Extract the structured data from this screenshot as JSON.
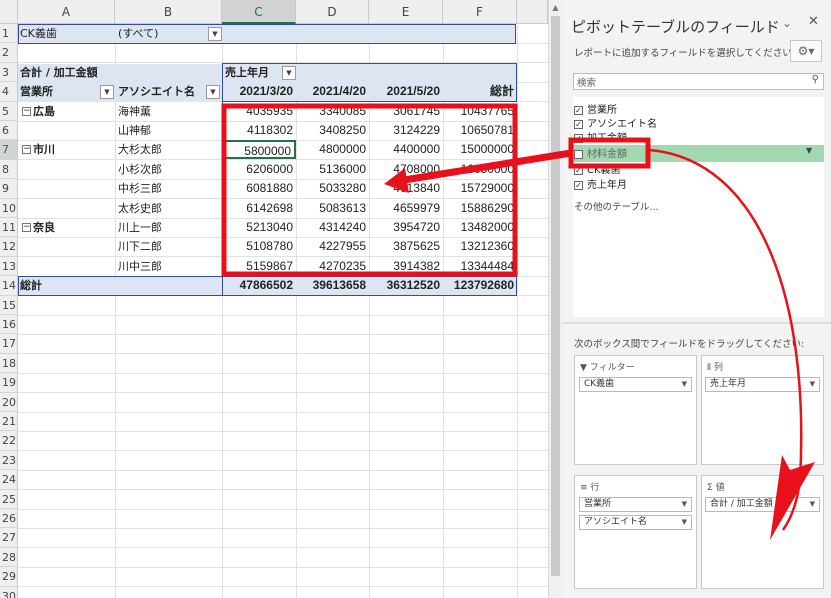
{
  "sheet": {
    "columns": [
      "A",
      "B",
      "C",
      "D",
      "E",
      "F"
    ],
    "rows": [
      "1",
      "2",
      "3",
      "4",
      "5",
      "6",
      "7",
      "8",
      "9",
      "10",
      "11",
      "12",
      "13",
      "14",
      "15",
      "16",
      "17",
      "18",
      "19",
      "20",
      "21",
      "22",
      "23",
      "24",
      "25",
      "26",
      "27",
      "28",
      "29",
      "30"
    ],
    "filter": {
      "label": "CK義歯",
      "value": "(すべて)"
    },
    "pivot": {
      "value_header": "合計 / 加工金額",
      "col_field": "売上年月",
      "row_field_1": "営業所",
      "row_field_2": "アソシエイト名",
      "dates": [
        "2021/3/20",
        "2021/4/20",
        "2021/5/20",
        "総計"
      ],
      "groups": [
        {
          "name": "広島",
          "members": [
            {
              "name": "海神薫",
              "values": [
                "4035935",
                "3340085",
                "3061745",
                "10437765"
              ]
            },
            {
              "name": "山神郁",
              "values": [
                "4118302",
                "3408250",
                "3124229",
                "10650781"
              ]
            }
          ]
        },
        {
          "name": "市川",
          "members": [
            {
              "name": "大杉太郎",
              "values": [
                "5800000",
                "4800000",
                "4400000",
                "15000000"
              ]
            },
            {
              "name": "小杉次郎",
              "values": [
                "6206000",
                "5136000",
                "4708000",
                "16050000"
              ]
            },
            {
              "name": "中杉三郎",
              "values": [
                "6081880",
                "5033280",
                "4613840",
                "15729000"
              ]
            },
            {
              "name": "太杉史郎",
              "values": [
                "6142698",
                "5083613",
                "4659979",
                "15886290"
              ]
            }
          ]
        },
        {
          "name": "奈良",
          "members": [
            {
              "name": "川上一郎",
              "values": [
                "5213040",
                "4314240",
                "3954720",
                "13482000"
              ]
            },
            {
              "name": "川下二郎",
              "values": [
                "5108780",
                "4227955",
                "3875625",
                "13212360"
              ]
            },
            {
              "name": "川中三郎",
              "values": [
                "5159867",
                "4270235",
                "3914382",
                "13344484"
              ]
            }
          ]
        }
      ],
      "total_label": "総計",
      "totals": [
        "47866502",
        "39613658",
        "36312520",
        "123792680"
      ]
    }
  },
  "pane": {
    "title": "ピボットテーブルのフィールド",
    "subtitle": "レポートに追加するフィールドを選択してください:",
    "search_placeholder": "検索",
    "fields": [
      {
        "label": "営業所",
        "checked": true
      },
      {
        "label": "アソシエイト名",
        "checked": true
      },
      {
        "label": "加工金額",
        "checked": true
      },
      {
        "label": "材料金額",
        "checked": false
      },
      {
        "label": "CK義歯",
        "checked": true
      },
      {
        "label": "売上年月",
        "checked": true
      }
    ],
    "more_tables": "その他のテーブル...",
    "drag_hint": "次のボックス間でフィールドをドラッグしてください:",
    "areas": {
      "filter": {
        "title": "フィルター",
        "item": "CK義歯"
      },
      "columns": {
        "title": "列",
        "item": "売上年月"
      },
      "rows": {
        "title": "行",
        "items": [
          "営業所",
          "アソシエイト名"
        ]
      },
      "values": {
        "title": "値",
        "item": "合計 / 加工金額"
      }
    }
  },
  "colors": {
    "annotation_red": "#e8101a",
    "pivot_blue": "#dde5f3",
    "excel_green": "#217346"
  }
}
